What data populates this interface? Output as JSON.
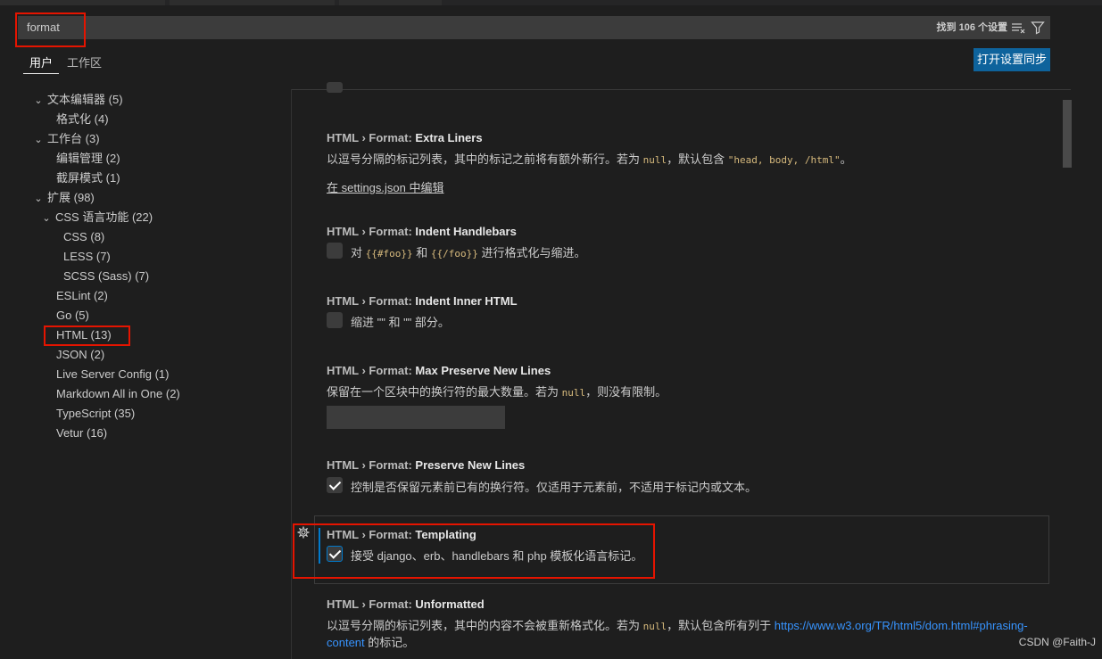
{
  "search": {
    "value": "format",
    "result_count": "找到 106 个设置"
  },
  "tabs": [
    {
      "label": "用户"
    },
    {
      "label": "工作区"
    }
  ],
  "sync_button": "打开设置同步",
  "tree": [
    {
      "label": "文本编辑器",
      "count": "(5)"
    },
    {
      "label": "格式化",
      "count": "(4)"
    },
    {
      "label": "工作台",
      "count": "(3)"
    },
    {
      "label": "编辑管理",
      "count": "(2)"
    },
    {
      "label": "截屏模式",
      "count": "(1)"
    },
    {
      "label": "扩展",
      "count": "(98)"
    },
    {
      "label": "CSS 语言功能",
      "count": "(22)"
    },
    {
      "label": "CSS",
      "count": "(8)"
    },
    {
      "label": "LESS",
      "count": "(7)"
    },
    {
      "label": "SCSS (Sass)",
      "count": "(7)"
    },
    {
      "label": "ESLint",
      "count": "(2)"
    },
    {
      "label": "Go",
      "count": "(5)"
    },
    {
      "label": "HTML",
      "count": "(13)"
    },
    {
      "label": "JSON",
      "count": "(2)"
    },
    {
      "label": "Live Server Config",
      "count": "(1)"
    },
    {
      "label": "Markdown All in One",
      "count": "(2)"
    },
    {
      "label": "TypeScript",
      "count": "(35)"
    },
    {
      "label": "Vetur",
      "count": "(16)"
    }
  ],
  "settings": {
    "extra_liners": {
      "category": "HTML › Format: ",
      "name": "Extra Liners",
      "desc_pre": "以逗号分隔的标记列表，其中的标记之前将有额外新行。若为 ",
      "desc_code1": "null",
      "desc_mid": "，默认包含 ",
      "desc_code2": "\"head, body, /html\"",
      "desc_post": "。",
      "edit_link": "在 settings.json 中编辑"
    },
    "indent_handlebars": {
      "category": "HTML › Format: ",
      "name": "Indent Handlebars",
      "desc_pre": "对 ",
      "desc_code1": "{{#foo}}",
      "desc_mid": " 和 ",
      "desc_code2": "{{/foo}}",
      "desc_post": " 进行格式化与缩进。",
      "checked": false
    },
    "indent_inner_html": {
      "category": "HTML › Format: ",
      "name": "Indent Inner HTML",
      "desc": "缩进 \"\" 和 \"\" 部分。",
      "checked": false
    },
    "max_preserve": {
      "category": "HTML › Format: ",
      "name": "Max Preserve New Lines",
      "desc_pre": "保留在一个区块中的换行符的最大数量。若为 ",
      "desc_code1": "null",
      "desc_post": "，则没有限制。",
      "value": ""
    },
    "preserve_new_lines": {
      "category": "HTML › Format: ",
      "name": "Preserve New Lines",
      "desc": "控制是否保留元素前已有的换行符。仅适用于元素前，不适用于标记内或文本。",
      "checked": true
    },
    "templating": {
      "category": "HTML › Format: ",
      "name": "Templating",
      "desc": "接受 django、erb、handlebars 和 php 模板化语言标记。",
      "checked": true
    },
    "unformatted": {
      "category": "HTML › Format: ",
      "name": "Unformatted",
      "desc_pre": "以逗号分隔的标记列表，其中的内容不会被重新格式化。若为 ",
      "desc_code1": "null",
      "desc_mid": "，默认包含所有列于 ",
      "link_a": "https://www.w3.org/TR/html5/dom.html#phrasing-",
      "link_b": "content",
      "desc_post": " 的标记。"
    }
  },
  "watermark": "CSDN @Faith-J",
  "colors": {
    "accent": "#007acc",
    "button": "#0e639c",
    "highlight_box": "#e51400",
    "code": "#d7ba7d",
    "link": "#3794ff"
  }
}
